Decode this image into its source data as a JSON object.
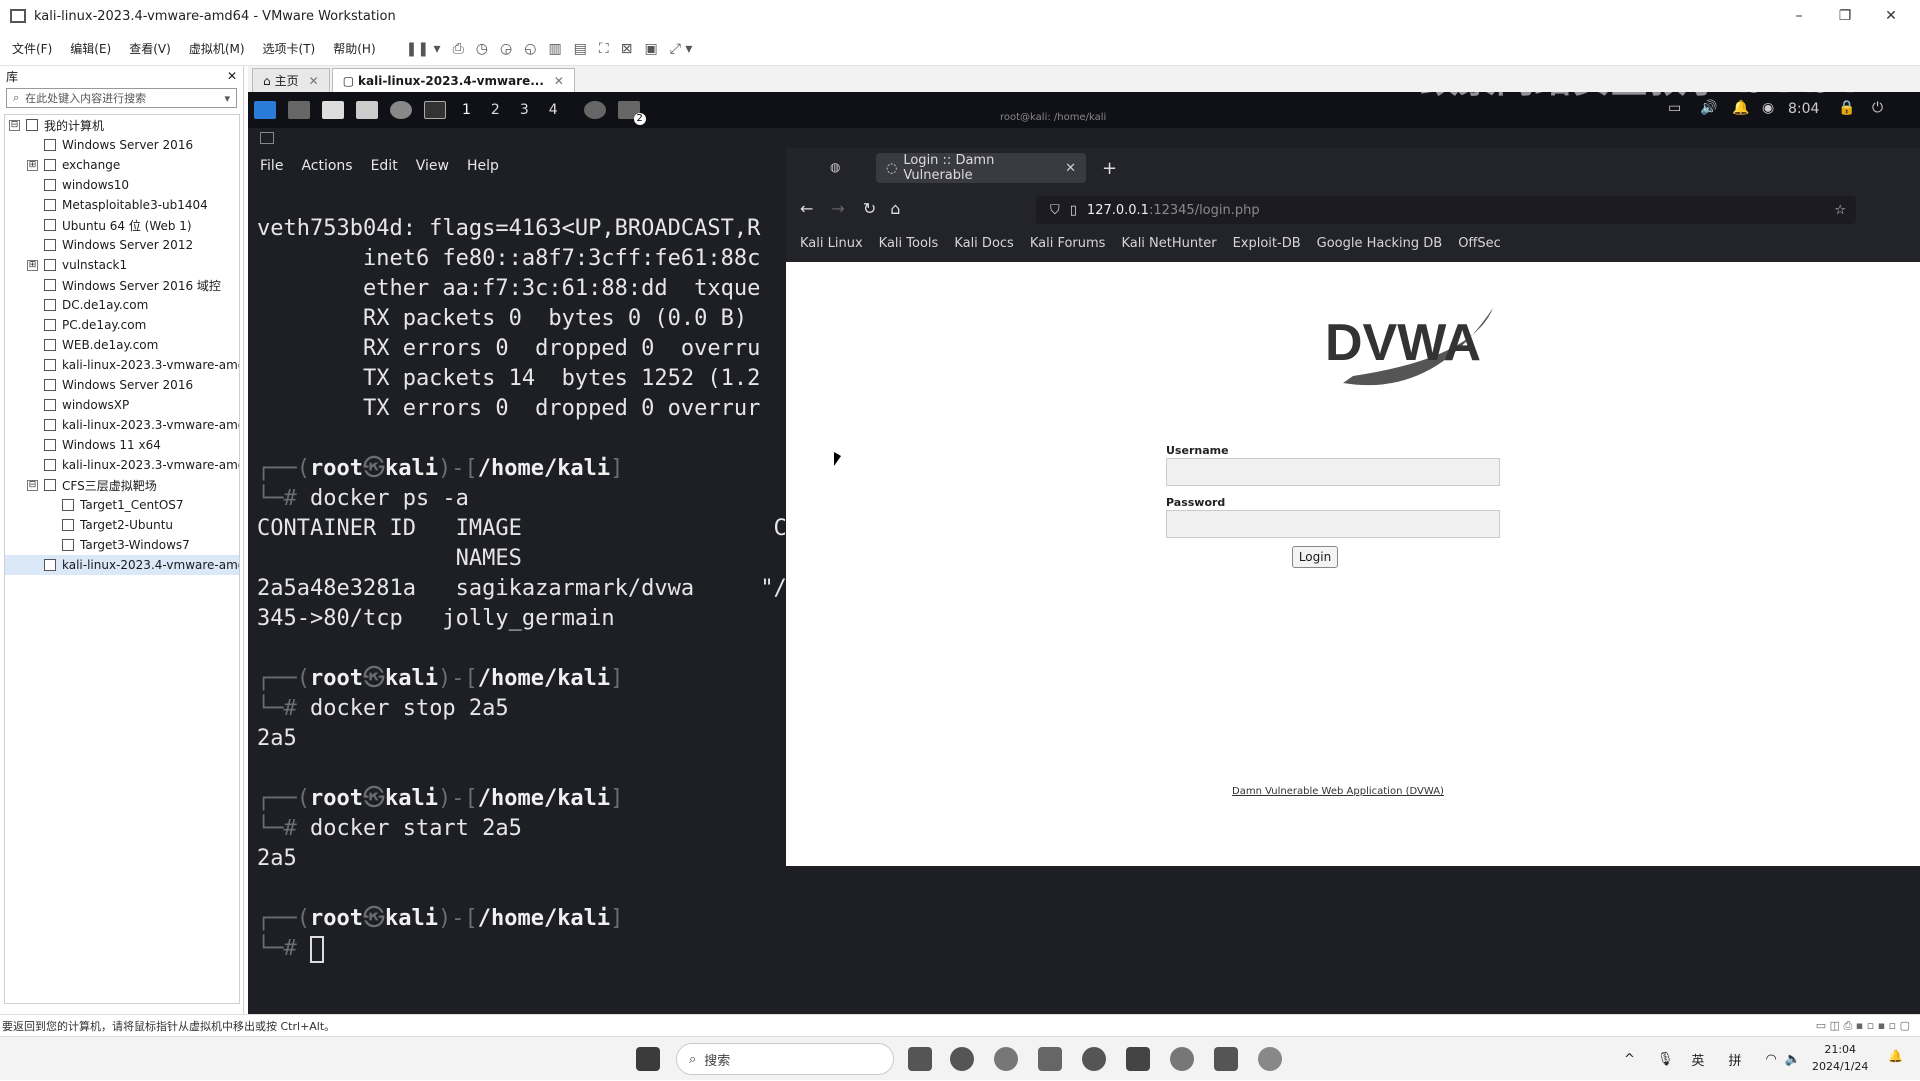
{
  "window": {
    "title": "kali-linux-2023.4-vmware-amd64 - VMware Workstation",
    "min": "–",
    "max": "❐",
    "close": "✕"
  },
  "menu": [
    "文件(F)",
    "编辑(E)",
    "查看(V)",
    "虚拟机(M)",
    "选项卡(T)",
    "帮助(H)"
  ],
  "library": {
    "title": "库",
    "close": "✕",
    "search_placeholder": "在此处键入内容进行搜索",
    "items": [
      {
        "label": "我的计算机",
        "level": 0,
        "exp": "⊟"
      },
      {
        "label": "Windows Server 2016",
        "level": 1
      },
      {
        "label": "exchange",
        "level": 1,
        "exp": "⊞"
      },
      {
        "label": "windows10",
        "level": 1
      },
      {
        "label": "Metasploitable3-ub1404",
        "level": 1
      },
      {
        "label": "Ubuntu 64 位 (Web 1)",
        "level": 1
      },
      {
        "label": "Windows Server 2012",
        "level": 1
      },
      {
        "label": "vulnstack1",
        "level": 1,
        "exp": "⊞"
      },
      {
        "label": "Windows Server 2016 域控",
        "level": 1
      },
      {
        "label": "DC.de1ay.com",
        "level": 1
      },
      {
        "label": "PC.de1ay.com",
        "level": 1
      },
      {
        "label": "WEB.de1ay.com",
        "level": 1
      },
      {
        "label": "kali-linux-2023.3-vmware-amd",
        "level": 1
      },
      {
        "label": "Windows Server 2016",
        "level": 1
      },
      {
        "label": "windowsXP",
        "level": 1
      },
      {
        "label": "kali-linux-2023.3-vmware-amd",
        "level": 1
      },
      {
        "label": "Windows 11 x64",
        "level": 1
      },
      {
        "label": "kali-linux-2023.3-vmware-amd",
        "level": 1
      },
      {
        "label": "CFS三层虚拟靶场",
        "level": 1,
        "exp": "⊟"
      },
      {
        "label": "Target1_CentOS7",
        "level": 2
      },
      {
        "label": "Target2-Ubuntu",
        "level": 2
      },
      {
        "label": "Target3-Windows7",
        "level": 2
      },
      {
        "label": "kali-linux-2023.4-vmware-amd",
        "level": 1
      }
    ]
  },
  "tabs": [
    {
      "label": "主页",
      "active": false
    },
    {
      "label": "kali-linux-2023.4-vmware...",
      "active": true
    }
  ],
  "watermark": "致景网络安全教学 bilibili",
  "kali_panel": {
    "workspaces": [
      "1",
      "2",
      "3",
      "4"
    ],
    "time": "8:04",
    "window_title": "root@kali: /home/kali",
    "badge": "2"
  },
  "terminal": {
    "menu": [
      "File",
      "Actions",
      "Edit",
      "View",
      "Help"
    ],
    "prompt_user": "root",
    "prompt_host": "kali",
    "prompt_path": "/home/kali",
    "iface_lines": [
      "veth753b04d: flags=4163<UP,BROADCAST,R",
      "        inet6 fe80::a8f7:3cff:fe61:88c",
      "        ether aa:f7:3c:61:88:dd  txque",
      "        RX packets 0  bytes 0 (0.0 B)",
      "        RX errors 0  dropped 0  overru",
      "        TX packets 14  bytes 1252 (1.2",
      "        TX errors 0  dropped 0 overrur"
    ],
    "cmd1": "docker ps -a",
    "ps_header1": "CONTAINER ID   IMAGE                   CO",
    "ps_header2": "               NAMES",
    "ps_row1": "2a5a48e3281a   sagikazarmark/dvwa     \"/",
    "ps_row2": "345->80/tcp   jolly_germain",
    "cmd2": "docker stop 2a5",
    "out2": "2a5",
    "cmd3": "docker start 2a5",
    "out3": "2a5"
  },
  "browser": {
    "tab_title": "Login :: Damn Vulnerable",
    "new_tab": "+",
    "url_host": "127.0.0.1",
    "url_path": ":12345/login.php",
    "bookmarks": [
      "Kali Linux",
      "Kali Tools",
      "Kali Docs",
      "Kali Forums",
      "Kali NetHunter",
      "Exploit-DB",
      "Google Hacking DB",
      "OffSec"
    ],
    "logo_text": "DVWA",
    "username_label": "Username",
    "password_label": "Password",
    "login_button": "Login",
    "footer_link": "Damn Vulnerable Web Application (DVWA)"
  },
  "status_bar": "要返回到您的计算机，请将鼠标指针从虚拟机中移出或按 Ctrl+Alt。",
  "taskbar": {
    "search_placeholder": "搜索",
    "ime1": "英",
    "ime2": "拼",
    "time": "21:04",
    "date": "2024/1/24"
  }
}
